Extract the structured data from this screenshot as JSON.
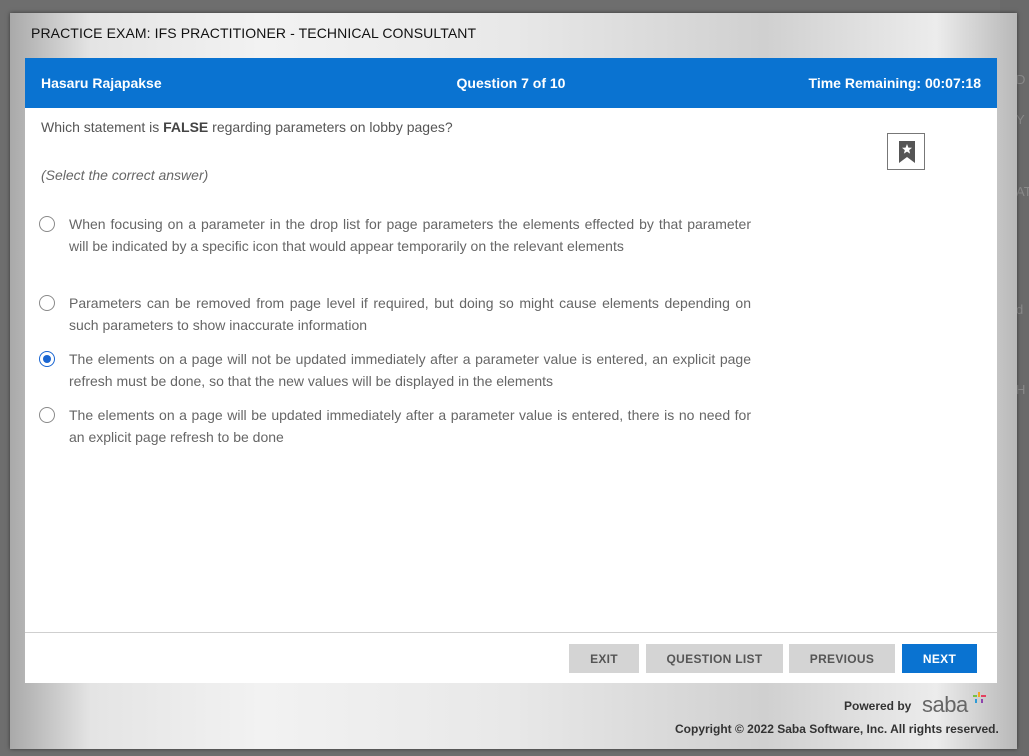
{
  "background": {
    "fragments": [
      "D",
      "Y",
      "AT",
      "d",
      "H"
    ]
  },
  "exam": {
    "title": "PRACTICE EXAM: IFS PRACTITIONER - TECHNICAL CONSULTANT"
  },
  "header": {
    "user": "Hasaru Rajapakse",
    "question": "Question 7 of 10",
    "time": "Time Remaining: 00:07:18"
  },
  "question": {
    "prefix": "Which statement is ",
    "emphasis": "FALSE",
    "suffix": " regarding parameters on lobby pages?",
    "instruction": "(Select the correct answer)",
    "bookmark_icon": "bookmark-star-icon",
    "selected_index": 2,
    "options": [
      {
        "text": "When focusing on a parameter in the drop list for page parameters the elements effected by that parameter will be indicated by a specific icon that would appear temporarily on the relevant elements"
      },
      {
        "text": "Parameters can be removed from page level if required, but doing so might cause elements depending on such parameters to show inaccurate information"
      },
      {
        "text": "The elements on a page will not be updated immediately after a parameter value is entered, an explicit page refresh must be done, so that the new values will be displayed in the elements"
      },
      {
        "text": "The elements on a page will be updated immediately after a parameter value is entered, there is no need for an explicit page refresh to be done"
      }
    ]
  },
  "buttons": {
    "exit": "EXIT",
    "question_list": "QUESTION LIST",
    "previous": "PREVIOUS",
    "next": "NEXT"
  },
  "branding": {
    "powered_by": "Powered by",
    "logo": "saba",
    "copyright": "Copyright © 2022 Saba Software, Inc. All rights reserved."
  },
  "colors": {
    "primary": "#0a73d1",
    "radio_selected": "#1a66d2",
    "button_grey": "#d4d4d4"
  }
}
